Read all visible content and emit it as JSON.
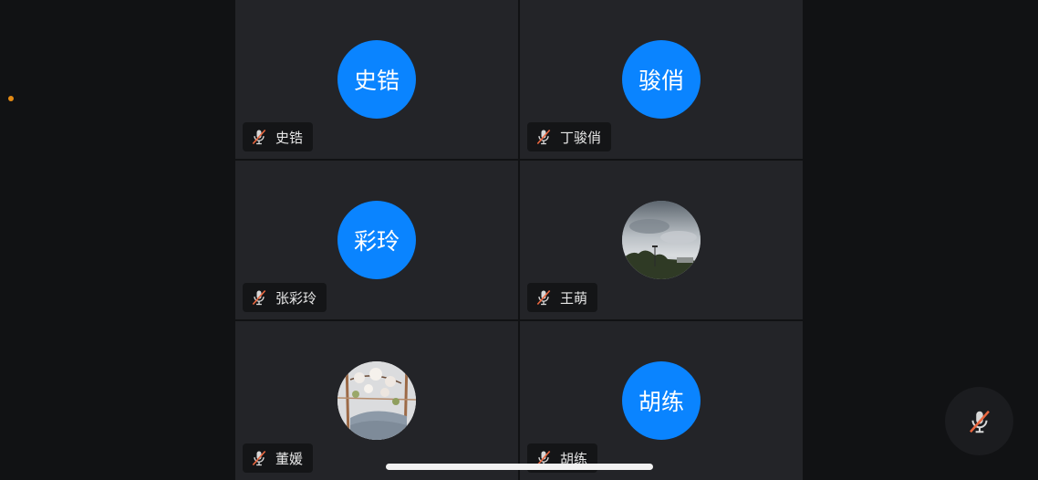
{
  "participants": [
    {
      "avatar_text": "史锆",
      "name": "史锆",
      "mic": "muted"
    },
    {
      "avatar_text": "骏俏",
      "name": "丁骏俏",
      "mic": "muted"
    },
    {
      "avatar_text": "彩玲",
      "name": "张彩玲",
      "mic": "muted"
    },
    {
      "avatar_text": "",
      "avatar_image": "sky-photo",
      "name": "王萌",
      "mic": "muted"
    },
    {
      "avatar_text": "",
      "avatar_image": "blossom-photo",
      "name": "董媛",
      "mic": "muted"
    },
    {
      "avatar_text": "胡练",
      "name": "胡练",
      "mic": "muted"
    }
  ],
  "controls": {
    "mic_toggle": "muted"
  },
  "colors": {
    "background": "#111214",
    "tile": "#232428",
    "avatar": "#0a84ff",
    "mute_slash": "#e8663f",
    "status_dot": "#e38a14"
  },
  "icons": [
    "mic-muted-icon",
    "home-indicator"
  ]
}
